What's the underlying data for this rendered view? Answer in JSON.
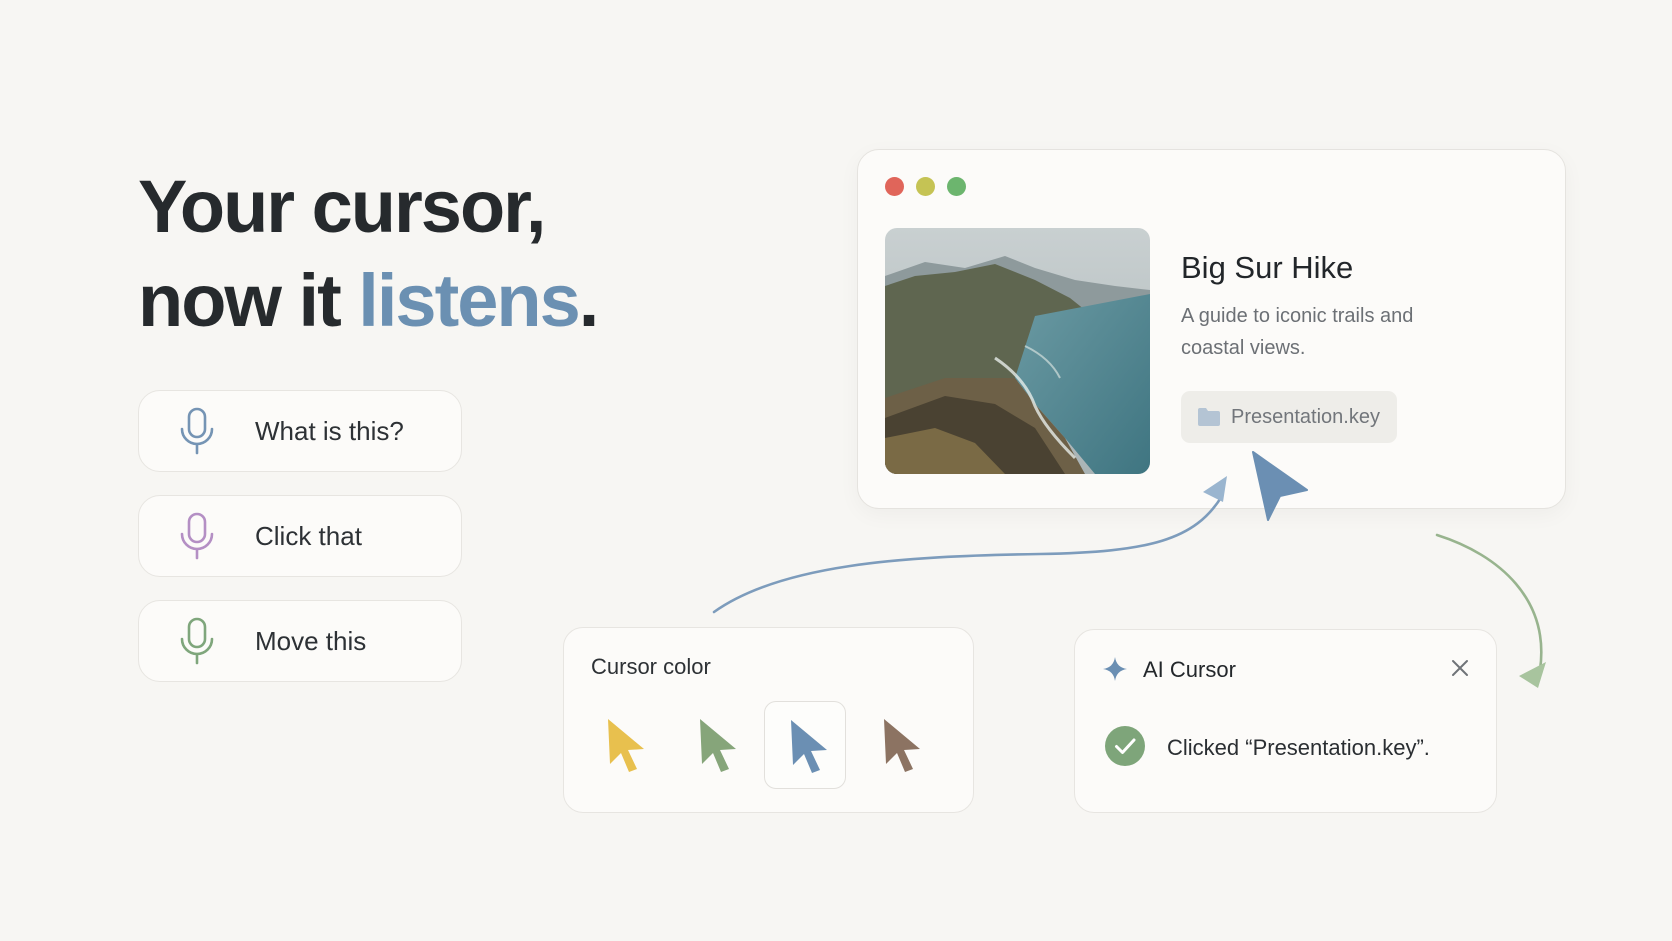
{
  "headline": {
    "line1": "Your cursor,",
    "line2_prefix": "now it ",
    "line2_accent": "listens",
    "line2_suffix": "."
  },
  "commands": [
    {
      "label": "What is this?",
      "mic_color": "#7594b4",
      "icon": "microphone-icon"
    },
    {
      "label": "Click that",
      "mic_color": "#b48fc4",
      "icon": "microphone-icon"
    },
    {
      "label": "Move this",
      "mic_color": "#7fa67c",
      "icon": "microphone-icon"
    }
  ],
  "window": {
    "controls": {
      "close": "#e0655a",
      "minimize": "#c5c354",
      "zoom": "#6cb56e"
    },
    "card": {
      "title": "Big Sur Hike",
      "description": "A guide to iconic trails and coastal views.",
      "file_name": "Presentation.key",
      "file_icon": "folder-icon"
    }
  },
  "cursor_color_panel": {
    "title": "Cursor color",
    "swatches": [
      {
        "color": "#e8c04e",
        "selected": false
      },
      {
        "color": "#86a57a",
        "selected": false
      },
      {
        "color": "#6b8fb3",
        "selected": true
      },
      {
        "color": "#8c7362",
        "selected": false
      }
    ]
  },
  "toast": {
    "title": "AI Cursor",
    "icon": "sparkle-icon",
    "message": "Clicked “Presentation.key”.",
    "status_icon": "check-circle-icon",
    "accent": "#6b8fb3",
    "success_color": "#7ea57a"
  }
}
